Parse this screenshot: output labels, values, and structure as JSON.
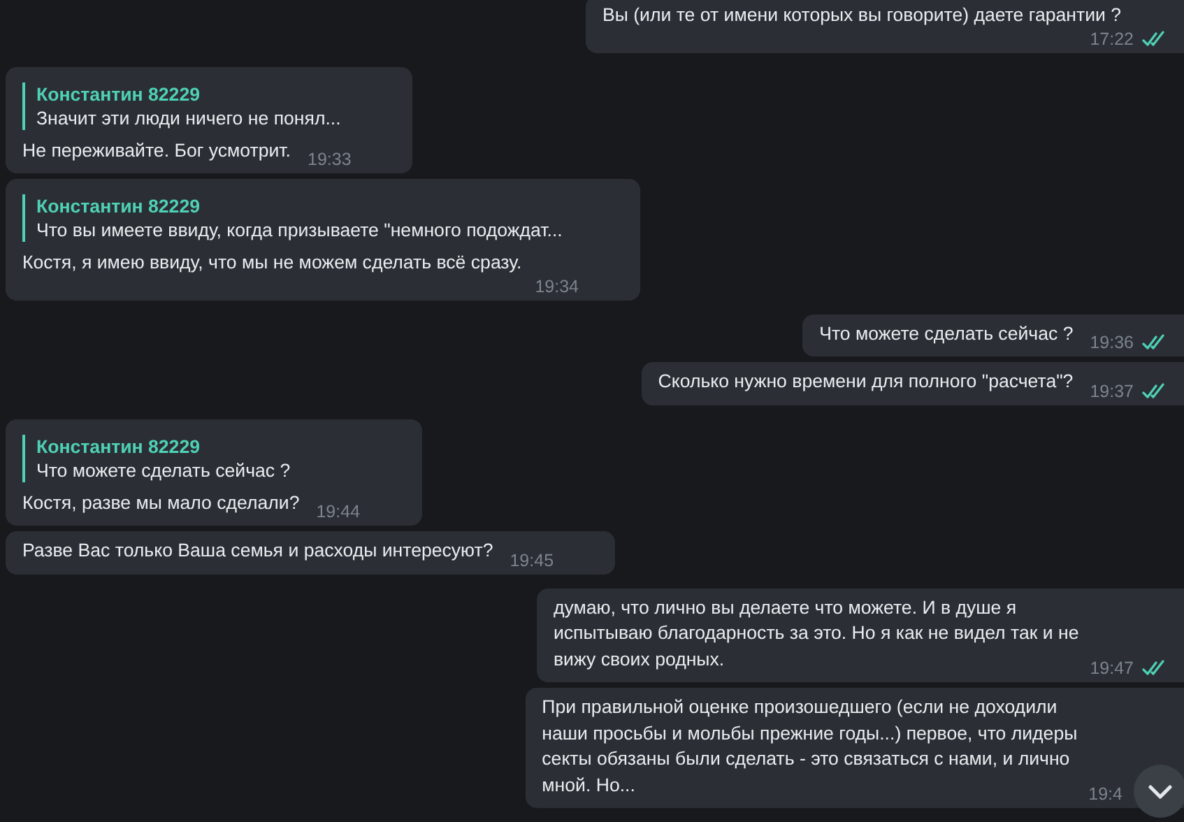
{
  "messages": [
    {
      "kind": "out",
      "text": "Вы (или те от имени которых вы говорите) даете гарантии ?",
      "time": "17:22",
      "read": true
    },
    {
      "kind": "in",
      "reply": {
        "author": "Константин 82229",
        "text": "Значит эти люди ничего не понял..."
      },
      "text": "Не переживайте. Бог усмотрит.",
      "time": "19:33"
    },
    {
      "kind": "in",
      "reply": {
        "author": "Константин 82229",
        "text": "Что вы имеете ввиду, когда призываете \"немного подождат..."
      },
      "text": "Костя, я имею ввиду, что мы не можем сделать всё сразу.",
      "time": "19:34"
    },
    {
      "kind": "out",
      "text": "Что можете сделать сейчас ?",
      "time": "19:36",
      "read": true
    },
    {
      "kind": "out",
      "text": "Сколько нужно времени для полного \"расчета\"?",
      "time": "19:37",
      "read": true
    },
    {
      "kind": "in",
      "reply": {
        "author": "Константин 82229",
        "text": "Что можете сделать сейчас ?"
      },
      "text": "Костя, разве мы мало сделали?",
      "time": "19:44"
    },
    {
      "kind": "in",
      "text": "Разве Вас только Ваша семья и расходы интересуют?",
      "time": "19:45"
    },
    {
      "kind": "out",
      "text": "думаю, что лично вы делаете что можете. И в душе я\nиспытываю благодарность за это. Но я как не видел так и не\nвижу своих родных.",
      "time": "19:47",
      "read": true
    },
    {
      "kind": "out",
      "text": "При правильной оценке произошедшего (если не доходили\nнаши просьбы и мольбы прежние годы...) первое, что лидеры\nсекты обязаны были сделать - это связаться с нами, и лично\nмной. Но...",
      "time": "19:4"
    }
  ]
}
